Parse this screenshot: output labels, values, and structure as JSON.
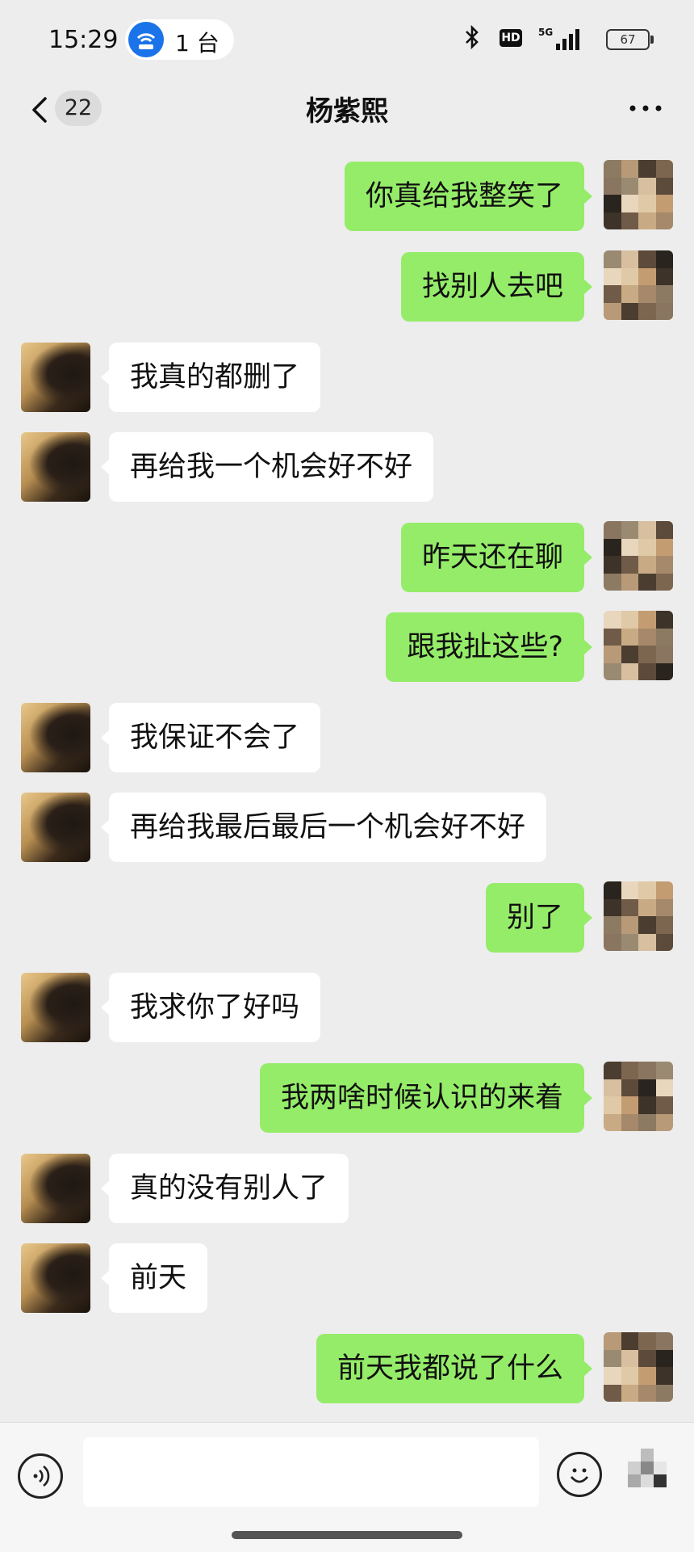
{
  "status_bar": {
    "time": "15:29",
    "hotspot_count": "1 台",
    "network": "5G",
    "hd_label": "HD",
    "battery": "67"
  },
  "header": {
    "unread_count": "22",
    "title": "杨紫熙"
  },
  "messages": [
    {
      "side": "out",
      "text": "你真给我整笑了"
    },
    {
      "side": "out",
      "text": "找别人去吧"
    },
    {
      "side": "in",
      "text": "我真的都删了"
    },
    {
      "side": "in",
      "text": "再给我一个机会好不好"
    },
    {
      "side": "out",
      "text": "昨天还在聊"
    },
    {
      "side": "out",
      "text": "跟我扯这些?"
    },
    {
      "side": "in",
      "text": "我保证不会了"
    },
    {
      "side": "in",
      "text": "再给我最后最后一个机会好不好"
    },
    {
      "side": "out",
      "text": "别了"
    },
    {
      "side": "in",
      "text": "我求你了好吗"
    },
    {
      "side": "out",
      "text": "我两啥时候认识的来着"
    },
    {
      "side": "in",
      "text": "真的没有别人了"
    },
    {
      "side": "in",
      "text": "前天"
    },
    {
      "side": "out",
      "text": "前天我都说了什么"
    }
  ],
  "input": {
    "placeholder": ""
  },
  "colors": {
    "background": "#ededed",
    "outgoing_bubble": "#95ec69",
    "incoming_bubble": "#ffffff",
    "hotspot_icon": "#1a73e8"
  },
  "icons": {
    "back": "chevron-left-icon",
    "more": "more-dots-icon",
    "voice": "voice-icon",
    "emoji": "emoji-icon",
    "hotspot": "hotspot-icon",
    "bluetooth": "bluetooth-icon"
  }
}
